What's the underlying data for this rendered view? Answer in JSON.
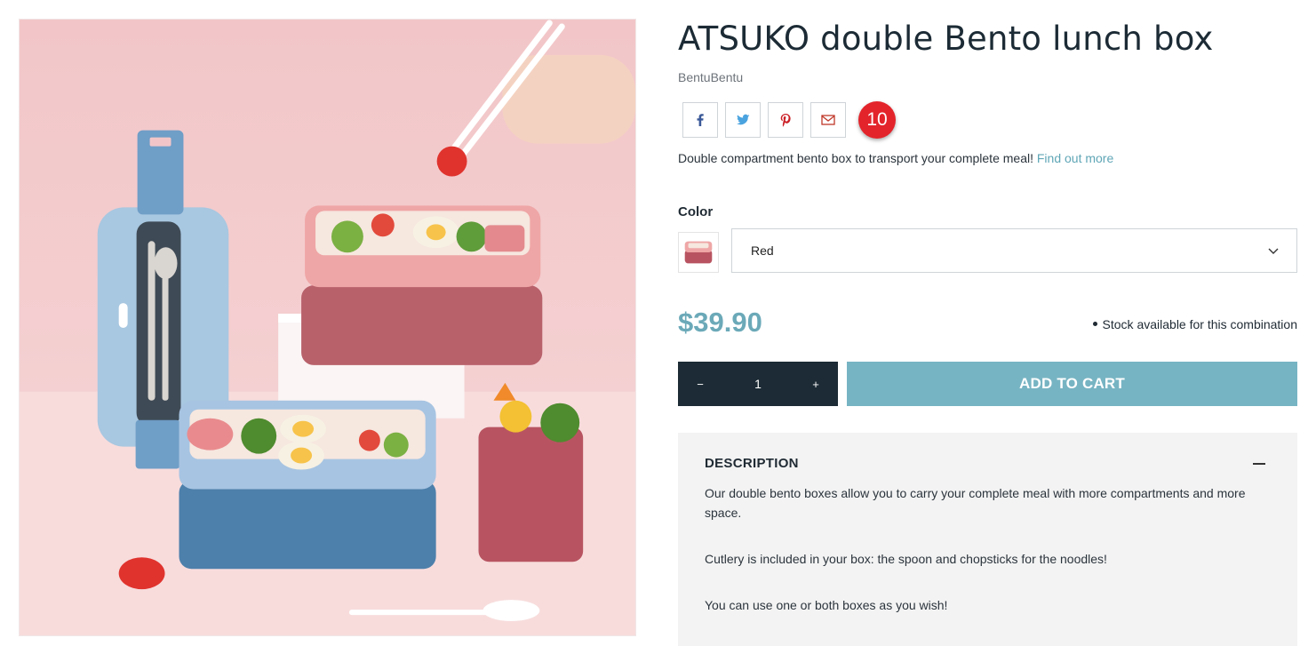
{
  "product": {
    "title": "ATSUKO double Bento lunch box",
    "brand": "BentuBentu",
    "short_description": "Double compartment bento box to transport your complete meal!",
    "find_out_more": "Find out more",
    "price": "$39.90",
    "stock_status": "Stock available for this combination"
  },
  "share": {
    "buttons": [
      "facebook",
      "twitter",
      "pinterest",
      "email"
    ],
    "count": "10"
  },
  "variant": {
    "label": "Color",
    "selected": "Red"
  },
  "quantity": {
    "decrement": "−",
    "value": "1",
    "increment": "+"
  },
  "cart": {
    "add_label": "ADD TO CART"
  },
  "description": {
    "title": "DESCRIPTION",
    "paragraphs": [
      "Our double bento boxes allow you to carry your complete meal with more compartments and more space.",
      "Cutlery is included in your box: the spoon and chopsticks for the noodles!",
      "You can use one or both boxes as you wish!"
    ]
  },
  "colors": {
    "accent": "#77b4c3",
    "price": "#6ba9b8",
    "dark": "#1c2b35",
    "badge": "#e3242b"
  }
}
